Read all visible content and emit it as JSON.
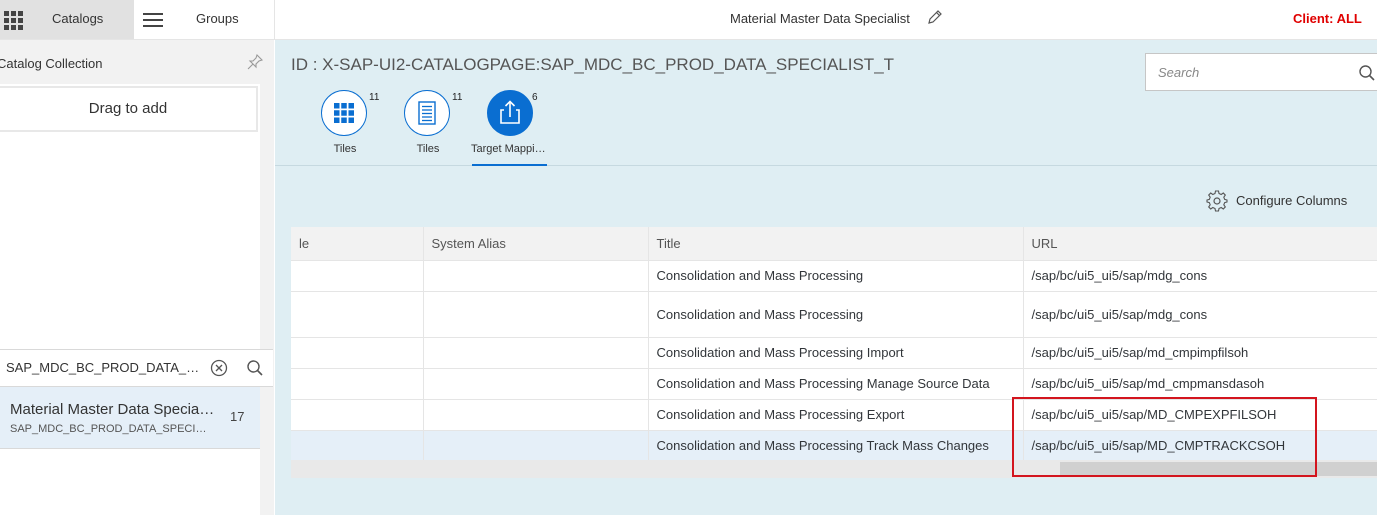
{
  "topbar": {
    "catalogs_label": "Catalogs",
    "groups_label": "Groups",
    "title": "Material Master Data Specialist",
    "client": "Client: ALL"
  },
  "left_panel": {
    "header": "Catalog Collection",
    "drag_label": "Drag to add",
    "search_value": "SAP_MDC_BC_PROD_DATA_SPECIALIST_T",
    "catalog_item": {
      "title": "Material Master Data Specialist",
      "subtitle": "SAP_MDC_BC_PROD_DATA_SPECIALIST_T",
      "count": "17"
    }
  },
  "main": {
    "page_id": "ID : X-SAP-UI2-CATALOGPAGE:SAP_MDC_BC_PROD_DATA_SPECIALIST_T",
    "search_placeholder": "Search",
    "tabs": [
      {
        "label": "Tiles",
        "count": "11",
        "icon": "grid-icon"
      },
      {
        "label": "Tiles",
        "count": "11",
        "icon": "list-icon"
      },
      {
        "label": "Target Mappings",
        "count": "6",
        "icon": "share-icon",
        "selected": true
      }
    ],
    "configure_columns": "Configure Columns",
    "table": {
      "headers": [
        "le",
        "System Alias",
        "Title",
        "URL"
      ],
      "rows": [
        {
          "c1": "",
          "c2": "",
          "title": "Consolidation and Mass Processing",
          "url": "/sap/bc/ui5_ui5/sap/mdg_cons"
        },
        {
          "c1": "",
          "c2": "",
          "title": "Consolidation and Mass Processing",
          "url": "/sap/bc/ui5_ui5/sap/mdg_cons"
        },
        {
          "c1": "",
          "c2": "",
          "title": "Consolidation and Mass Processing Import",
          "url": "/sap/bc/ui5_ui5/sap/md_cmpimpfilsoh"
        },
        {
          "c1": "",
          "c2": "",
          "title": "Consolidation and Mass Processing Manage Source Data",
          "url": "/sap/bc/ui5_ui5/sap/md_cmpmansdasoh"
        },
        {
          "c1": "",
          "c2": "",
          "title": "Consolidation and Mass Processing Export",
          "url": "/sap/bc/ui5_ui5/sap/MD_CMPEXPFILSOH"
        },
        {
          "c1": "",
          "c2": "",
          "title": "Consolidation and Mass Processing Track Mass Changes",
          "url": "/sap/bc/ui5_ui5/sap/MD_CMPTRACKCSOH"
        }
      ]
    }
  },
  "colors": {
    "accent": "#0a6ed1",
    "client_red": "#e00000",
    "highlight_box": "#d3151e",
    "main_bg": "#dfeef3"
  }
}
